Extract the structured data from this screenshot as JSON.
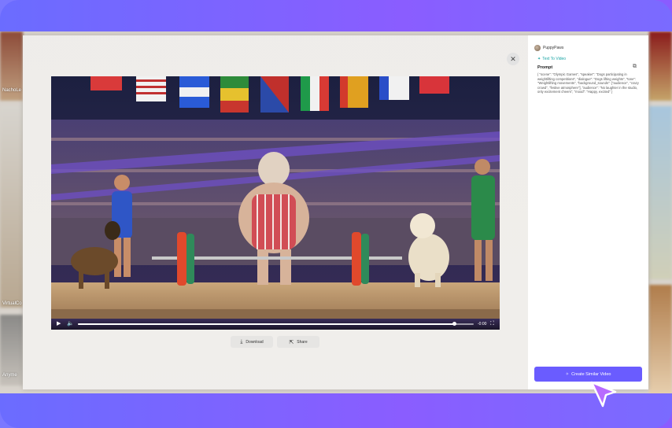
{
  "gallery": {
    "labels": [
      "NachoLe",
      "VirtualCo",
      "Anyme"
    ]
  },
  "modal": {
    "close_icon": "close-icon",
    "video": {
      "time": "-0:00",
      "progress": 0.95,
      "play_icon": "play-icon",
      "volume_icon": "volume-icon",
      "fullscreen_icon": "fullscreen-icon"
    },
    "actions": {
      "download_label": "Download",
      "share_label": "Share"
    },
    "panel": {
      "username": "PuppyPaws",
      "mode": "Text To Video",
      "prompt_heading": "Prompt",
      "prompt_text": "{ \"scene\": \"Olympic Games\", \"speaker\": \"Dogs participating in weightlifting competitions\", \"dialogue\": \"Dogs lifting weights\", \"tone\": \"Weightlifting movements\", \"background_sounds\": [\"audience\", \"crazy crowd\", \"festive atmosphere\"], \"audience\": \"No laughter in the studio, only excitement cheers\", \"mood\": \"Happy, excited\" }",
      "create_label": "Create Similar Video"
    }
  },
  "colors": {
    "brand_purple": "#6a5cff",
    "accent_teal": "#1aa5a5"
  }
}
